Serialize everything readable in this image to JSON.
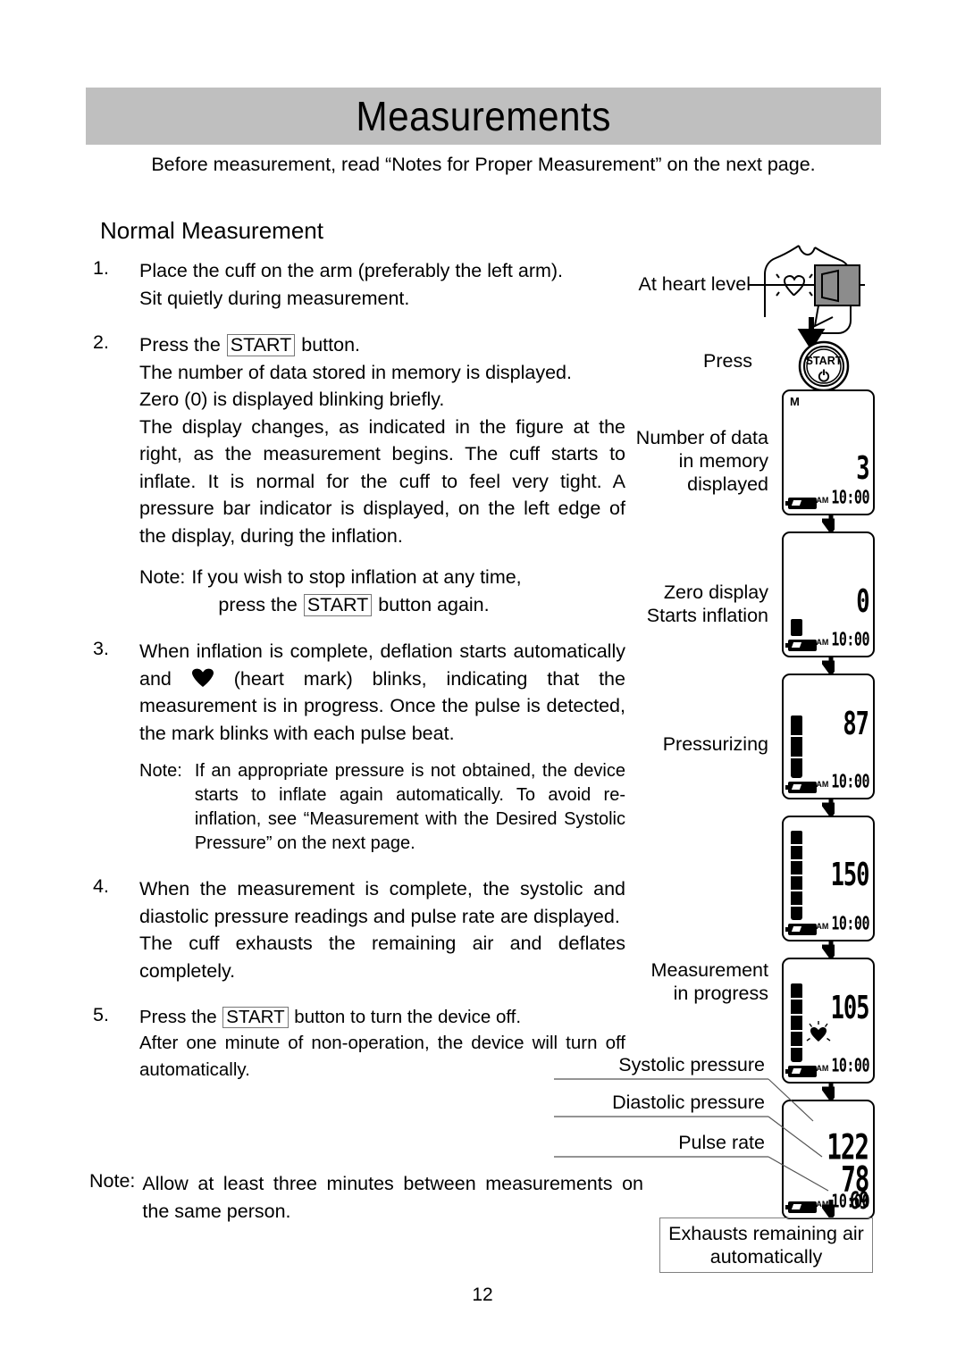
{
  "header": {
    "title": "Measurements",
    "intro": "Before measurement, read “Notes for Proper Measurement” on the next page."
  },
  "section": {
    "heading": "Normal Measurement"
  },
  "steps": [
    {
      "num": "1.",
      "lines": [
        "Place the cuff on the arm (preferably the left arm).",
        "Sit quietly during measurement."
      ]
    },
    {
      "num": "2.",
      "lead_before": "Press the ",
      "lead_key": "START",
      "lead_after": " button.",
      "lines": [
        "The number of data stored in memory is displayed.",
        "Zero (0) is displayed blinking briefly.",
        "The display changes, as indicated in the figure at the right, as the measurement begins. The cuff starts to inflate. It is normal for the cuff to feel very tight. A pressure bar indicator is displayed, on the left edge of the display, during the inflation."
      ],
      "note": {
        "label": "Note:",
        "line1": "If you wish to stop inflation at any time,",
        "line2_before": "press the ",
        "line2_key": "START",
        "line2_after": " button again."
      }
    },
    {
      "num": "3.",
      "text_before_heart": "When inflation is complete, deflation starts automatically and ",
      "heart_icon": "heart-mark",
      "text_after_heart": " (heart mark) blinks, indicating that the measurement is in progress. Once the pulse is detected, the mark blinks with each pulse beat.",
      "note": {
        "label": "Note:",
        "text": "If an appropriate pressure is not obtained, the device starts to inflate again automatically. To avoid re-inflation, see “Measurement with the Desired Systolic Pressure” on the next page."
      }
    },
    {
      "num": "4.",
      "lines": [
        "When the measurement is complete, the systolic and diastolic pressure readings and pulse rate are displayed.",
        "The cuff exhausts the remaining air and deflates completely."
      ]
    },
    {
      "num": "5.",
      "lead_before": "Press the ",
      "lead_key": "START",
      "lead_after": " button to turn the device off.",
      "lines": [
        "After one minute of non-operation, the device will turn off automatically."
      ]
    }
  ],
  "footnote": {
    "label": "Note:",
    "text": "Allow at least three minutes between measurements on the same person."
  },
  "page_number": "12",
  "figure": {
    "heart_level_label": "At heart level",
    "press_label": "Press",
    "start_button_label": "START",
    "labels": {
      "memory": "Number of data\nin memory\ndisplayed",
      "zero": "Zero  display\nStarts inflation",
      "pressurizing": "Pressurizing",
      "in_progress": "Measurement\nin progress"
    },
    "callouts": {
      "systolic": "Systolic pressure",
      "diastolic": "Diastolic pressure",
      "pulse": "Pulse rate"
    },
    "exhaust_box": "Exhausts remaining\nair automatically",
    "lcds": [
      {
        "id": "lcd-memory",
        "memory_icon": "M",
        "value": "3",
        "am": "AM",
        "clock": "10:00",
        "bar_segments": 0
      },
      {
        "id": "lcd-zero",
        "memory_icon": "",
        "value": "0",
        "am": "AM",
        "clock": "10:00",
        "bar_segments": 1
      },
      {
        "id": "lcd-pressurizing",
        "memory_icon": "",
        "value": "87",
        "am": "AM",
        "clock": "10:00",
        "bar_segments": 3
      },
      {
        "id": "lcd-peak",
        "memory_icon": "",
        "value": "150",
        "am": "AM",
        "clock": "10:00",
        "bar_segments": 6
      },
      {
        "id": "lcd-progress",
        "memory_icon": "",
        "value": "105",
        "am": "AM",
        "clock": "10:00",
        "bar_segments": 5,
        "heart_blink": true
      },
      {
        "id": "lcd-result",
        "memory_icon": "",
        "systolic": "122",
        "diastolic": "78",
        "pulse": "69",
        "am": "AM",
        "clock": "10:00",
        "bar_segments": 0
      }
    ]
  },
  "colors": {
    "band": "#bfbfbf",
    "cuff": "#8c8c8c",
    "rule": "#555555"
  }
}
